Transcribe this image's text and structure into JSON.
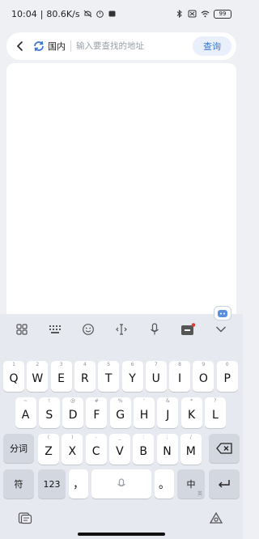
{
  "status_bar": {
    "time": "10:04",
    "separator": "|",
    "speed": "80.6K/s",
    "battery": "99"
  },
  "search_bar": {
    "region_label": "国内",
    "placeholder": "输入要查找的地址",
    "query_label": "查询"
  },
  "keyboard": {
    "toolbar_icons": [
      "grid-icon",
      "keyboard-icon",
      "emoji-icon",
      "cursor-icon",
      "microphone-icon",
      "toolbox-icon",
      "collapse-icon"
    ],
    "row1": [
      {
        "hint": "1",
        "key": "Q"
      },
      {
        "hint": "2",
        "key": "W"
      },
      {
        "hint": "3",
        "key": "E"
      },
      {
        "hint": "4",
        "key": "R"
      },
      {
        "hint": "5",
        "key": "T"
      },
      {
        "hint": "6",
        "key": "Y"
      },
      {
        "hint": "7",
        "key": "U"
      },
      {
        "hint": "8",
        "key": "I"
      },
      {
        "hint": "9",
        "key": "O"
      },
      {
        "hint": "0",
        "key": "P"
      }
    ],
    "row2": [
      {
        "hint": "~",
        "key": "A"
      },
      {
        "hint": "!",
        "key": "S"
      },
      {
        "hint": "@",
        "key": "D"
      },
      {
        "hint": "#",
        "key": "F"
      },
      {
        "hint": "%",
        "key": "G"
      },
      {
        "hint": "'",
        "key": "H"
      },
      {
        "hint": "&",
        "key": "J"
      },
      {
        "hint": "*",
        "key": "K"
      },
      {
        "hint": "?",
        "key": "L"
      }
    ],
    "row3": [
      {
        "hint": "(",
        "key": "Z"
      },
      {
        "hint": ")",
        "key": "X"
      },
      {
        "hint": "-",
        "key": "C"
      },
      {
        "hint": "_",
        "key": "V"
      },
      {
        "hint": ":",
        "key": "B"
      },
      {
        "hint": ";",
        "key": "N"
      },
      {
        "hint": "/",
        "key": "M"
      }
    ],
    "fenci": "分词",
    "fu": "符",
    "num": "123",
    "comma": "，",
    "period": "。",
    "zhong": "中",
    "zhong_sub": "英"
  },
  "colors": {
    "accent": "#3a76d8",
    "keyboard_bg": "#e6e9ef",
    "func_key": "#d3d7df"
  }
}
